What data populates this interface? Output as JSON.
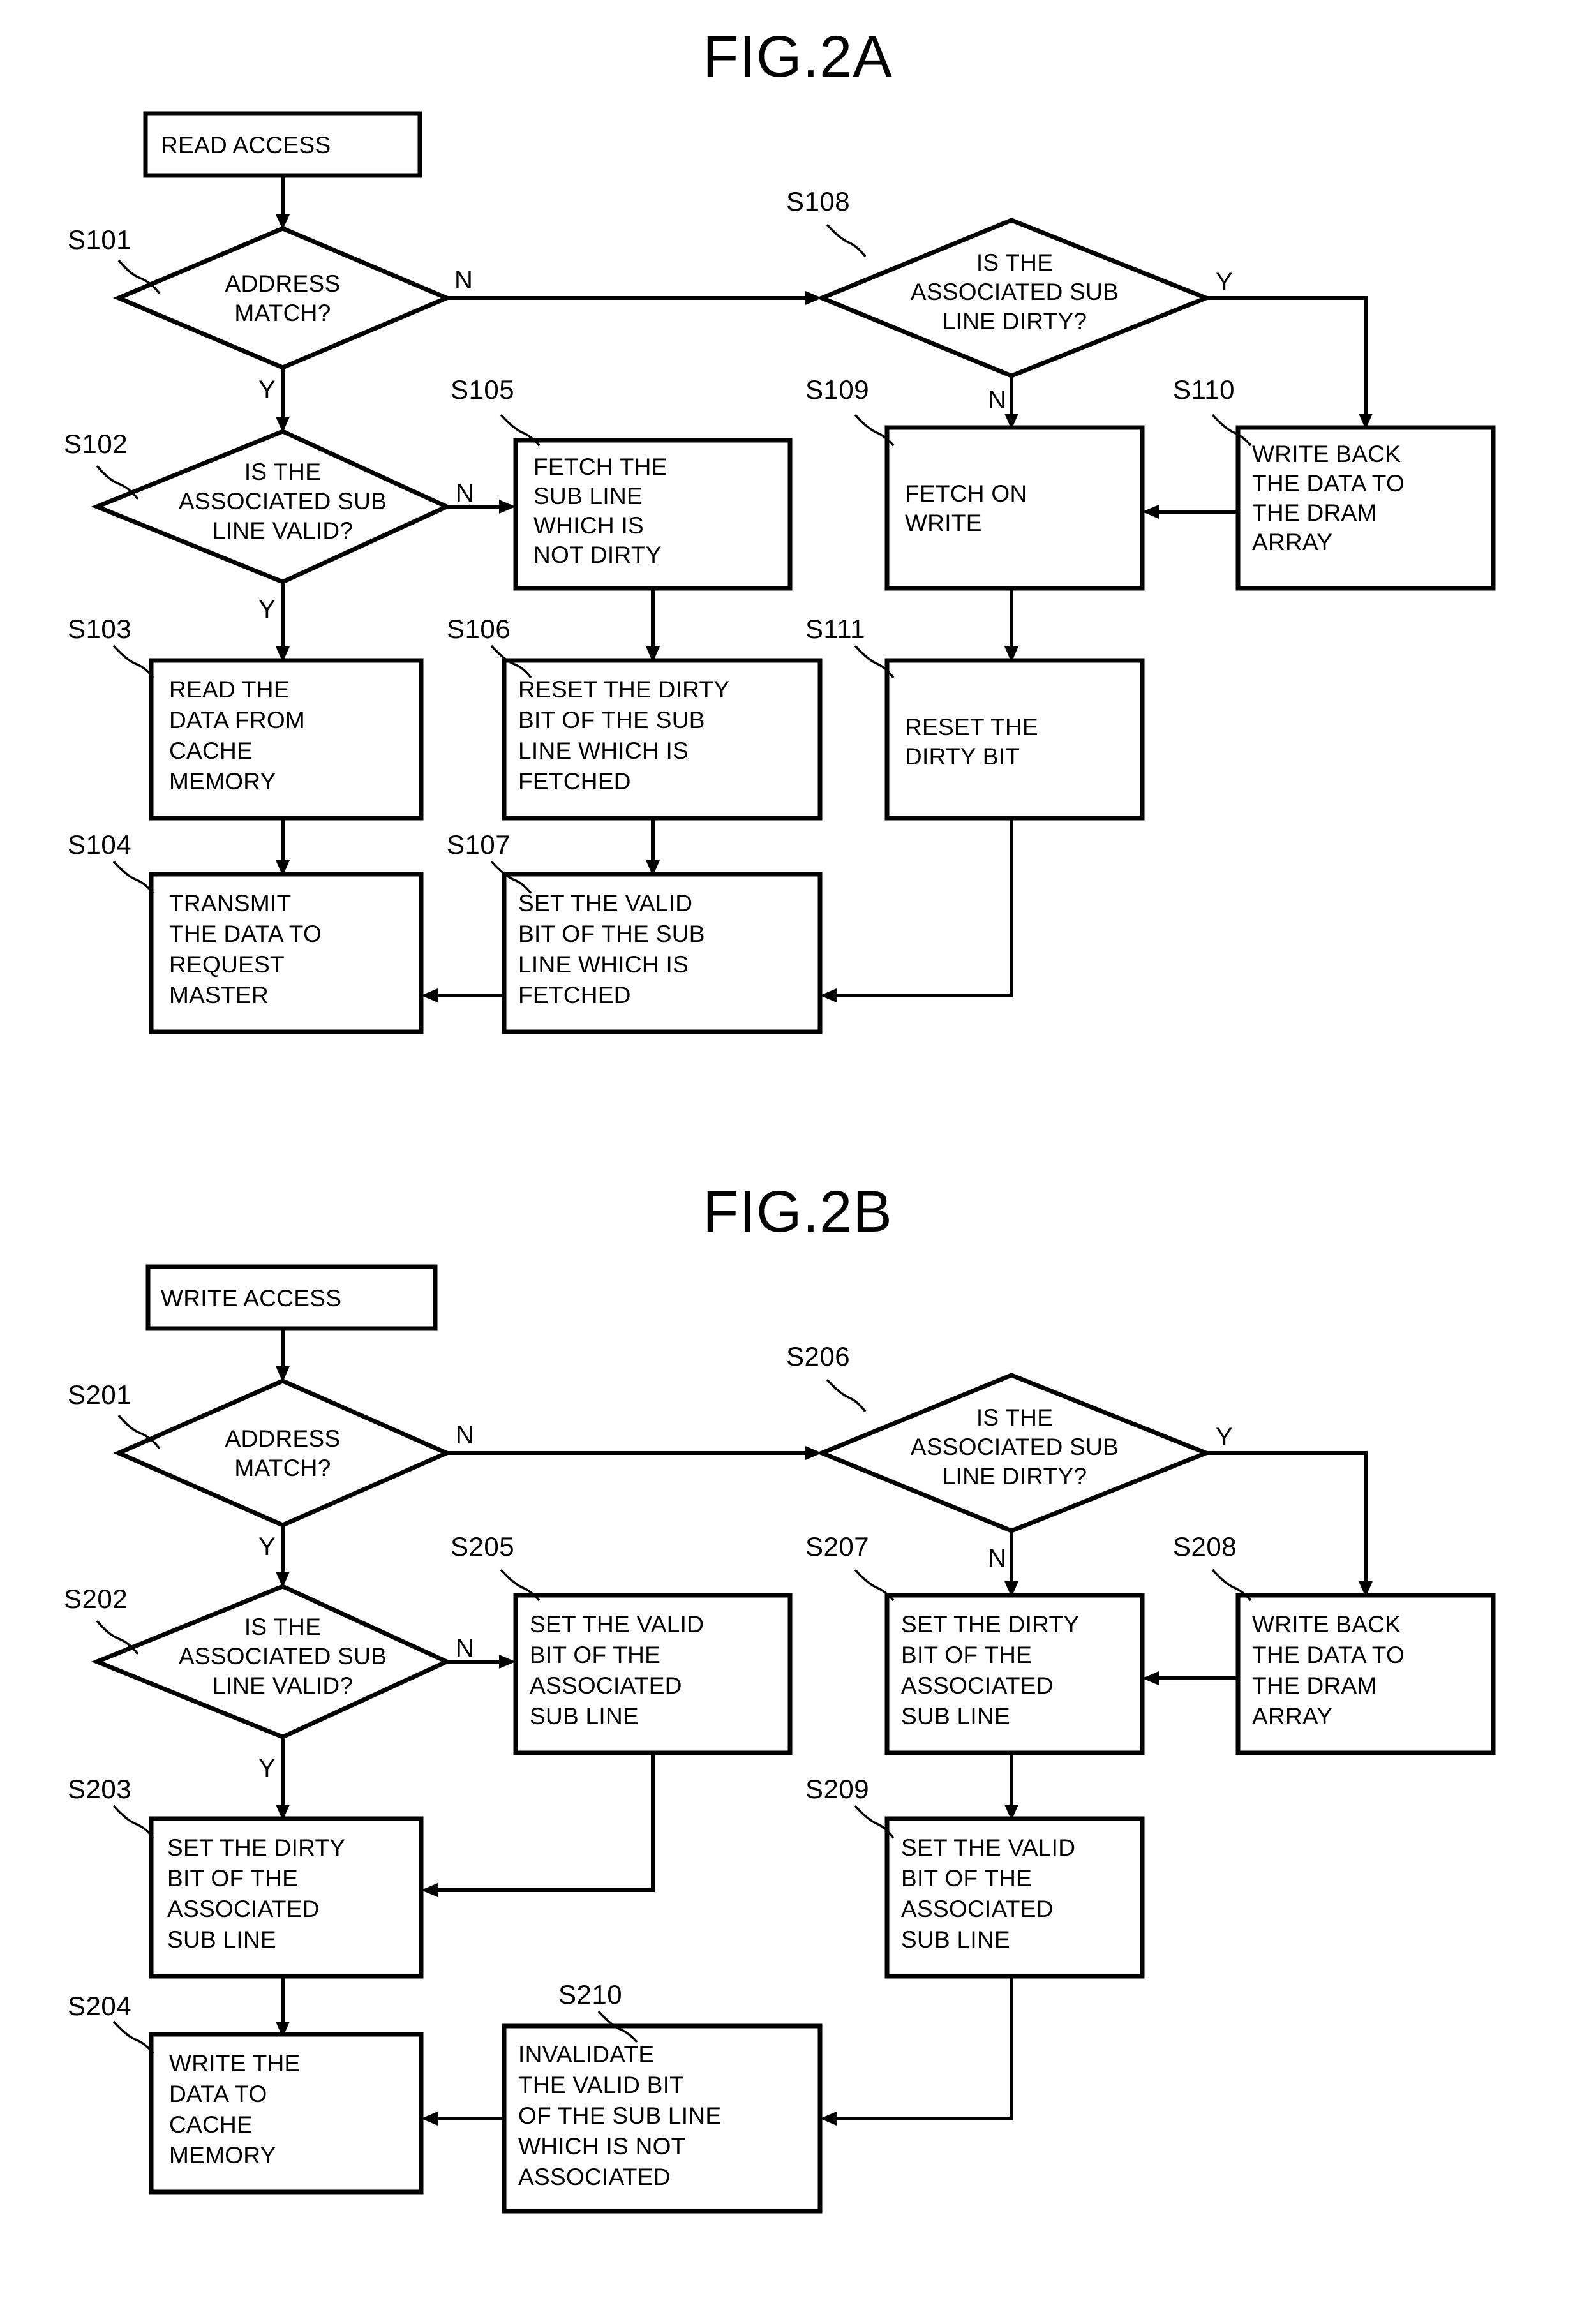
{
  "figures": [
    {
      "id": "fig2a",
      "title": "FIG.2A",
      "start": {
        "label": "READ ACCESS"
      },
      "steps": [
        {
          "ref": "S101",
          "text": "ADDRESS MATCH?",
          "lines": [
            "ADDRESS",
            "MATCH?"
          ],
          "shape": "diamond"
        },
        {
          "ref": "S102",
          "text": "IS THE ASSOCIATED SUB LINE VALID?",
          "lines": [
            "IS THE",
            "ASSOCIATED SUB",
            "LINE VALID?"
          ],
          "shape": "diamond"
        },
        {
          "ref": "S103",
          "text": "READ THE DATA FROM CACHE MEMORY",
          "lines": [
            "READ THE",
            "DATA FROM",
            "CACHE",
            "MEMORY"
          ],
          "shape": "box"
        },
        {
          "ref": "S104",
          "text": "TRANSMIT THE DATA TO REQUEST MASTER",
          "lines": [
            "TRANSMIT",
            "THE DATA TO",
            "REQUEST",
            "MASTER"
          ],
          "shape": "box"
        },
        {
          "ref": "S105",
          "text": "FETCH THE SUB LINE WHICH IS NOT DIRTY",
          "lines": [
            "FETCH THE",
            "SUB LINE",
            "WHICH IS",
            "NOT DIRTY"
          ],
          "shape": "box"
        },
        {
          "ref": "S106",
          "text": "RESET THE DIRTY BIT OF THE SUB LINE WHICH IS FETCHED",
          "lines": [
            "RESET THE DIRTY",
            "BIT OF THE SUB",
            "LINE WHICH IS",
            "FETCHED"
          ],
          "shape": "box"
        },
        {
          "ref": "S107",
          "text": "SET THE VALID BIT OF THE SUB LINE WHICH IS FETCHED",
          "lines": [
            "SET THE VALID",
            "BIT OF THE SUB",
            "LINE WHICH IS",
            "FETCHED"
          ],
          "shape": "box"
        },
        {
          "ref": "S108",
          "text": "IS THE ASSOCIATED SUB LINE DIRTY?",
          "lines": [
            "IS THE",
            "ASSOCIATED SUB",
            "LINE DIRTY?"
          ],
          "shape": "diamond"
        },
        {
          "ref": "S109",
          "text": "FETCH ON WRITE",
          "lines": [
            "FETCH ON",
            "WRITE"
          ],
          "shape": "box"
        },
        {
          "ref": "S110",
          "text": "WRITE BACK THE DATA TO THE DRAM ARRAY",
          "lines": [
            "WRITE BACK",
            "THE DATA TO",
            "THE DRAM",
            "ARRAY"
          ],
          "shape": "box"
        },
        {
          "ref": "S111",
          "text": "RESET THE DIRTY BIT",
          "lines": [
            "RESET THE",
            "DIRTY BIT"
          ],
          "shape": "box"
        }
      ],
      "branches": [
        {
          "from": "S101",
          "label": "N"
        },
        {
          "from": "S101",
          "label": "Y"
        },
        {
          "from": "S102",
          "label": "N"
        },
        {
          "from": "S102",
          "label": "Y"
        },
        {
          "from": "S108",
          "label": "Y"
        },
        {
          "from": "S108",
          "label": "N"
        }
      ]
    },
    {
      "id": "fig2b",
      "title": "FIG.2B",
      "start": {
        "label": "WRITE ACCESS"
      },
      "steps": [
        {
          "ref": "S201",
          "text": "ADDRESS MATCH?",
          "lines": [
            "ADDRESS",
            "MATCH?"
          ],
          "shape": "diamond"
        },
        {
          "ref": "S202",
          "text": "IS THE ASSOCIATED SUB LINE VALID?",
          "lines": [
            "IS THE",
            "ASSOCIATED SUB",
            "LINE VALID?"
          ],
          "shape": "diamond"
        },
        {
          "ref": "S203",
          "text": "SET THE DIRTY BIT OF THE ASSOCIATED SUB LINE",
          "lines": [
            "SET THE DIRTY",
            "BIT OF THE",
            "ASSOCIATED",
            "SUB LINE"
          ],
          "shape": "box"
        },
        {
          "ref": "S204",
          "text": "WRITE THE DATA TO CACHE MEMORY",
          "lines": [
            "WRITE THE",
            "DATA TO",
            "CACHE",
            "MEMORY"
          ],
          "shape": "box"
        },
        {
          "ref": "S205",
          "text": "SET THE VALID BIT OF THE ASSOCIATED SUB LINE",
          "lines": [
            "SET THE VALID",
            "BIT OF THE",
            "ASSOCIATED",
            "SUB LINE"
          ],
          "shape": "box"
        },
        {
          "ref": "S206",
          "text": "IS THE ASSOCIATED SUB LINE DIRTY?",
          "lines": [
            "IS THE",
            "ASSOCIATED SUB",
            "LINE DIRTY?"
          ],
          "shape": "diamond"
        },
        {
          "ref": "S207",
          "text": "SET THE DIRTY BIT OF THE ASSOCIATED SUB LINE",
          "lines": [
            "SET THE DIRTY",
            "BIT OF THE",
            "ASSOCIATED",
            "SUB LINE"
          ],
          "shape": "box"
        },
        {
          "ref": "S208",
          "text": "WRITE BACK THE DATA TO THE DRAM ARRAY",
          "lines": [
            "WRITE BACK",
            "THE DATA TO",
            "THE DRAM",
            "ARRAY"
          ],
          "shape": "box"
        },
        {
          "ref": "S209",
          "text": "SET THE VALID BIT OF THE ASSOCIATED SUB LINE",
          "lines": [
            "SET THE VALID",
            "BIT OF THE",
            "ASSOCIATED",
            "SUB LINE"
          ],
          "shape": "box"
        },
        {
          "ref": "S210",
          "text": "INVALIDATE THE VALID BIT OF THE SUB LINE WHICH IS NOT ASSOCIATED",
          "lines": [
            "INVALIDATE",
            "THE VALID BIT",
            "OF THE SUB LINE",
            "WHICH IS NOT",
            "ASSOCIATED"
          ],
          "shape": "box"
        }
      ],
      "branches": [
        {
          "from": "S201",
          "label": "N"
        },
        {
          "from": "S201",
          "label": "Y"
        },
        {
          "from": "S202",
          "label": "N"
        },
        {
          "from": "S202",
          "label": "Y"
        },
        {
          "from": "S206",
          "label": "Y"
        },
        {
          "from": "S206",
          "label": "N"
        }
      ]
    }
  ],
  "colors": {
    "ink": "#000000",
    "paper": "#ffffff"
  }
}
